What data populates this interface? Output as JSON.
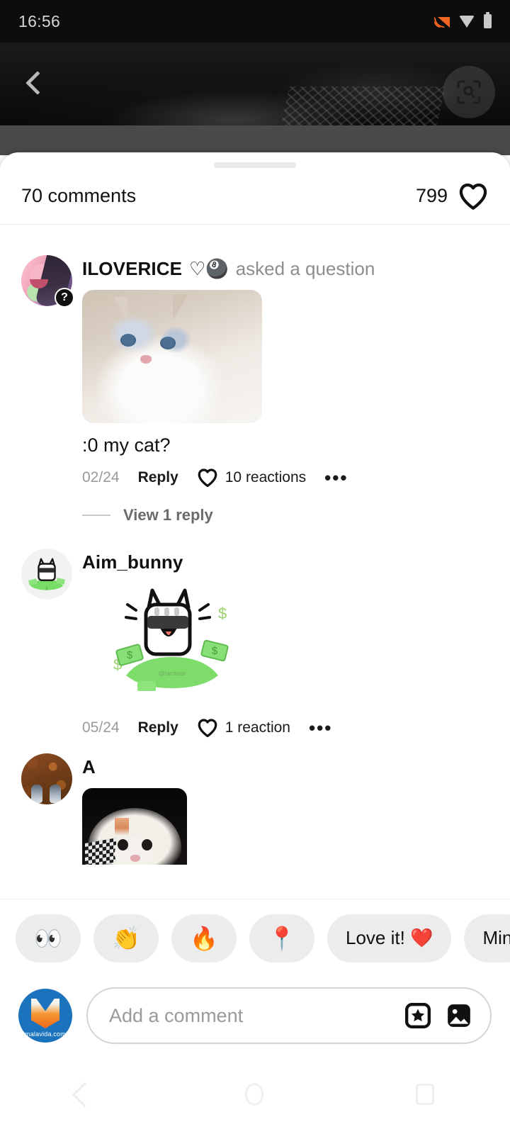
{
  "status_bar": {
    "time": "16:56",
    "icons": [
      "cast-icon",
      "wifi-icon",
      "battery-icon"
    ]
  },
  "media": {
    "back_icon": "back-chevron-icon",
    "lens_button_icon": "visual-search-icon"
  },
  "sheet": {
    "grabber": "drag-handle",
    "comments_label": "70 comments",
    "likes_count": "799",
    "like_icon": "heart-outline-icon"
  },
  "comments": [
    {
      "avatar": "anime-avatar",
      "badge_icon": "question-badge-icon",
      "badge_label": "?",
      "username": "ILOVERICE",
      "name_suffix": "♡🎱",
      "status": "asked a question",
      "attachment": "cat-photo",
      "text": ":0 my cat?",
      "date": "02/24",
      "reply_label": "Reply",
      "reaction_icon": "heart-outline-icon",
      "reactions": "10 reactions",
      "more_icon": "more-options-icon",
      "more_label": "•••",
      "view_replies": "View 1 reply"
    },
    {
      "avatar": "money-cat-avatar",
      "username": "Aim_bunny",
      "attachment": "money-cat-sticker",
      "sticker_watermark": "@tacitear",
      "date": "05/24",
      "reply_label": "Reply",
      "reaction_icon": "heart-outline-icon",
      "reactions": "1 reaction",
      "more_icon": "more-options-icon",
      "more_label": "•••"
    },
    {
      "avatar": "leaves-photo-avatar",
      "username": "A",
      "attachment": "dark-cat-photo"
    }
  ],
  "quick_reactions": [
    {
      "name": "eyes",
      "emoji": "👀",
      "label": ""
    },
    {
      "name": "clap",
      "emoji": "👏",
      "label": ""
    },
    {
      "name": "fire",
      "emoji": "🔥",
      "label": ""
    },
    {
      "name": "pushpin",
      "emoji": "📍",
      "label": ""
    },
    {
      "name": "love-it",
      "emoji": "",
      "label": "Love it! ❤️"
    },
    {
      "name": "mind-blowing",
      "emoji": "",
      "label": "Min"
    }
  ],
  "composer": {
    "brand_name": "malavida.com",
    "placeholder": "Add a comment",
    "value": "",
    "sticker_icon": "sticker-star-icon",
    "image_icon": "image-gallery-icon"
  },
  "navbar": {
    "back": "nav-back-icon",
    "home": "nav-home-icon",
    "recents": "nav-recents-icon"
  },
  "colors": {
    "accent_orange": "#f26522",
    "brand_blue": "#1c73bd",
    "chip_bg": "#ececec",
    "muted_text": "#8d8d8d"
  }
}
